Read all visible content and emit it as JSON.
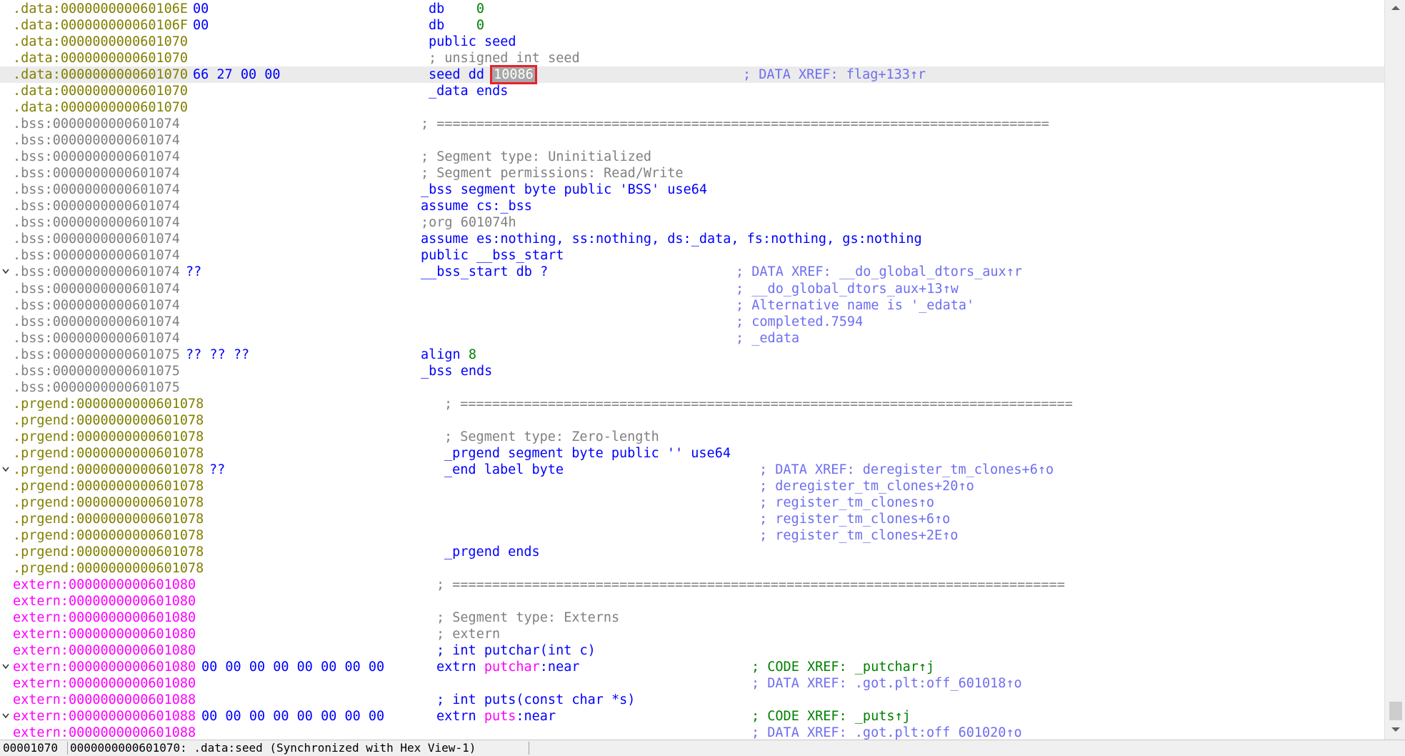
{
  "rows": [
    {
      "addr": ".data:000000000060106E",
      "seg": "data",
      "bytes": "00",
      "ins": "db    0"
    },
    {
      "addr": ".data:000000000060106F",
      "seg": "data",
      "bytes": "00",
      "ins": "db    0"
    },
    {
      "addr": ".data:0000000000601070",
      "seg": "data",
      "ins": "public seed"
    },
    {
      "addr": ".data:0000000000601070",
      "seg": "data",
      "ins": "; unsigned int seed"
    },
    {
      "addr": ".data:0000000000601070",
      "seg": "data",
      "bytes": "66 27 00 00",
      "ins_prefix": "seed dd ",
      "ins_cursor": "10086",
      "cmt": "; DATA XREF: flag+133↑r"
    },
    {
      "addr": ".data:0000000000601070",
      "seg": "data",
      "ins": "_data ends"
    },
    {
      "addr": ".data:0000000000601070",
      "seg": "data"
    },
    {
      "addr": ".bss:0000000000601074",
      "seg": "bss",
      "ins": "; ============================================================================="
    },
    {
      "addr": ".bss:0000000000601074",
      "seg": "bss"
    },
    {
      "addr": ".bss:0000000000601074",
      "seg": "bss",
      "ins": "; Segment type: Uninitialized"
    },
    {
      "addr": ".bss:0000000000601074",
      "seg": "bss",
      "ins": "; Segment permissions: Read/Write"
    },
    {
      "addr": ".bss:0000000000601074",
      "seg": "bss",
      "ins": "_bss segment byte public 'BSS' use64"
    },
    {
      "addr": ".bss:0000000000601074",
      "seg": "bss",
      "ins": "assume cs:_bss"
    },
    {
      "addr": ".bss:0000000000601074",
      "seg": "bss",
      "ins": ";org 601074h"
    },
    {
      "addr": ".bss:0000000000601074",
      "seg": "bss",
      "ins": "assume es:nothing, ss:nothing, ds:_data, fs:nothing, gs:nothing"
    },
    {
      "addr": ".bss:0000000000601074",
      "seg": "bss",
      "ins": "public __bss_start"
    },
    {
      "addr": ".bss:0000000000601074",
      "seg": "bss",
      "arrow": true,
      "bytes": "??",
      "ins": "__bss_start db ?",
      "cmt": "; DATA XREF: __do_global_dtors_aux↑r"
    },
    {
      "addr": ".bss:0000000000601074",
      "seg": "bss",
      "cmt": "; __do_global_dtors_aux+13↑w"
    },
    {
      "addr": ".bss:0000000000601074",
      "seg": "bss",
      "cmt": "; Alternative name is '_edata'"
    },
    {
      "addr": ".bss:0000000000601074",
      "seg": "bss",
      "cmt": "; completed.7594"
    },
    {
      "addr": ".bss:0000000000601074",
      "seg": "bss",
      "cmt": "; _edata"
    },
    {
      "addr": ".bss:0000000000601075",
      "seg": "bss",
      "bytes": "?? ?? ??",
      "ins": "align 8"
    },
    {
      "addr": ".bss:0000000000601075",
      "seg": "bss",
      "ins": "_bss ends"
    },
    {
      "addr": ".bss:0000000000601075",
      "seg": "bss"
    },
    {
      "addr": ".prgend:0000000000601078",
      "seg": "prgend",
      "ins": "; ============================================================================="
    },
    {
      "addr": ".prgend:0000000000601078",
      "seg": "prgend"
    },
    {
      "addr": ".prgend:0000000000601078",
      "seg": "prgend",
      "ins": "; Segment type: Zero-length"
    },
    {
      "addr": ".prgend:0000000000601078",
      "seg": "prgend",
      "ins": "_prgend segment byte public '' use64"
    },
    {
      "addr": ".prgend:0000000000601078",
      "seg": "prgend",
      "arrow": true,
      "bytes": "??",
      "ins": "_end label byte",
      "cmt": "; DATA XREF: deregister_tm_clones+6↑o"
    },
    {
      "addr": ".prgend:0000000000601078",
      "seg": "prgend",
      "cmt": "; deregister_tm_clones+20↑o"
    },
    {
      "addr": ".prgend:0000000000601078",
      "seg": "prgend",
      "cmt": "; register_tm_clones↑o"
    },
    {
      "addr": ".prgend:0000000000601078",
      "seg": "prgend",
      "cmt": "; register_tm_clones+6↑o"
    },
    {
      "addr": ".prgend:0000000000601078",
      "seg": "prgend",
      "cmt": "; register_tm_clones+2E↑o"
    },
    {
      "addr": ".prgend:0000000000601078",
      "seg": "prgend",
      "ins": "_prgend ends"
    },
    {
      "addr": ".prgend:0000000000601078",
      "seg": "prgend"
    },
    {
      "addr": "extern:0000000000601080",
      "seg": "extern",
      "ins": "; ============================================================================="
    },
    {
      "addr": "extern:0000000000601080",
      "seg": "extern"
    },
    {
      "addr": "extern:0000000000601080",
      "seg": "extern",
      "ins": "; Segment type: Externs"
    },
    {
      "addr": "extern:0000000000601080",
      "seg": "extern",
      "ins": "; extern"
    },
    {
      "addr": "extern:0000000000601080",
      "seg": "extern",
      "ins": "; int putchar(int c)"
    },
    {
      "addr": "extern:0000000000601080",
      "seg": "extern",
      "arrow": true,
      "bytes": "00 00 00 00 00 00 00 00",
      "ins_kw": "extrn ",
      "ins_name": "putchar",
      "ins_tail": ":near",
      "cmt": "; CODE XREF: _putchar↑j",
      "cmt_green": true
    },
    {
      "addr": "extern:0000000000601080",
      "seg": "extern",
      "cmt": "; DATA XREF: .got.plt:off_601018↑o"
    },
    {
      "addr": "extern:0000000000601088",
      "seg": "extern",
      "ins": "; int puts(const char *s)"
    },
    {
      "addr": "extern:0000000000601088",
      "seg": "extern",
      "arrow": true,
      "bytes": "00 00 00 00 00 00 00 00",
      "ins_kw": "extrn ",
      "ins_name": "puts",
      "ins_tail": ":near",
      "cmt": "; CODE XREF: _puts↑j",
      "cmt_green": true
    },
    {
      "addr": "extern:0000000000601088",
      "seg": "extern",
      "cmt": "; DATA XREF: .got.plt:off_601020↑o"
    }
  ],
  "status": {
    "offset": "00001070",
    "location": "0000000000601070: .data:seed (Synchronized with Hex View-1)"
  },
  "colors": {
    "data_addr": "#808000",
    "bss_addr": "#808080",
    "extern_addr": "#ff00ff",
    "instruction": "#0000ff",
    "comment": "#6e6ef0",
    "cursor_outline": "#e8212b"
  }
}
